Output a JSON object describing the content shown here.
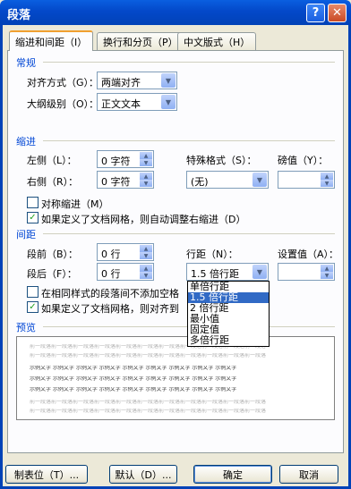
{
  "window": {
    "title": "段落",
    "help_label": "?",
    "close_label": "✕"
  },
  "tabs": [
    "缩进和间距（I）",
    "换行和分页（P）",
    "中文版式（H）"
  ],
  "general": {
    "header": "常规",
    "alignment_label": "对齐方式（G）：",
    "alignment_value": "两端对齐",
    "outline_label": "大纲级别（O）：",
    "outline_value": "正文文本"
  },
  "indent": {
    "header": "缩进",
    "left_label": "左侧（L）：",
    "left_value": "0 字符",
    "right_label": "右侧（R）：",
    "right_value": "0 字符",
    "special_label": "特殊格式（S）：",
    "special_value": "(无)",
    "by_label": "磅值（Y）：",
    "by_value": "",
    "mirror_label": "对称缩进（M）",
    "mirror_checked": false,
    "auto_adjust_label": "如果定义了文档网格，则自动调整右缩进（D）",
    "auto_adjust_checked": true
  },
  "spacing": {
    "header": "间距",
    "before_label": "段前（B）：",
    "before_value": "0 行",
    "after_label": "段后（F）：",
    "after_value": "0 行",
    "line_label": "行距（N）：",
    "line_value": "1.5 倍行距",
    "at_label": "设置值（A）：",
    "at_value": "",
    "no_space_label": "在相同样式的段落间不添加空格",
    "no_space_checked": false,
    "snap_label": "如果定义了文档网格，则对齐到",
    "snap_checked": true,
    "line_options": [
      "单倍行距",
      "1.5 倍行距",
      "2 倍行距",
      "最小值",
      "固定值",
      "多倍行距"
    ],
    "line_selected_index": 1
  },
  "preview": {
    "header": "预览",
    "grey_text": "前一段落前一段落前一段落前一段落前一段落前一段落前一段落前一段落前一段落前一段落前一段落",
    "sample_text": "示例文字 示例文字 示例文字 示例文字 示例文字 示例文字 示例文字 示例文字 示例文字"
  },
  "buttons": {
    "tabs": "制表位（T）...",
    "default": "默认（D）...",
    "ok": "确定",
    "cancel": "取消"
  }
}
